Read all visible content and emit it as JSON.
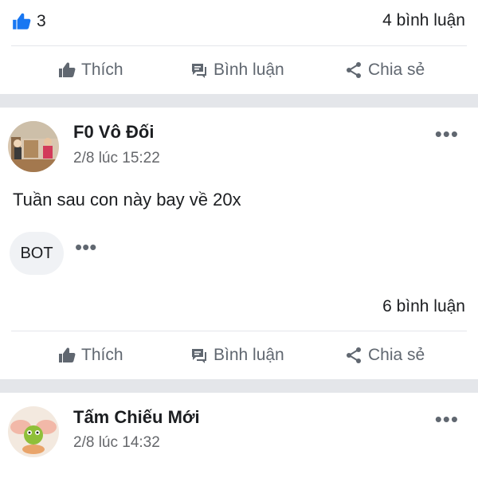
{
  "post1": {
    "like_count": "3",
    "comment_count": "4 bình luận"
  },
  "actions": {
    "like": "Thích",
    "comment": "Bình luận",
    "share": "Chia sẻ"
  },
  "post2": {
    "author": "F0 Vô Đối",
    "timestamp": "2/8 lúc 15:22",
    "text": "Tuần sau con này bay về 20x",
    "tag": "BOT",
    "tag_more": "•••",
    "more": "•••",
    "comment_count": "6 bình luận"
  },
  "post3": {
    "author": "Tấm Chiếu Mới",
    "timestamp": "2/8 lúc 14:32",
    "more": "•••"
  },
  "colors": {
    "like_blue": "#1877f2",
    "action_gray": "#606770",
    "separator": "#e4e6ea"
  }
}
